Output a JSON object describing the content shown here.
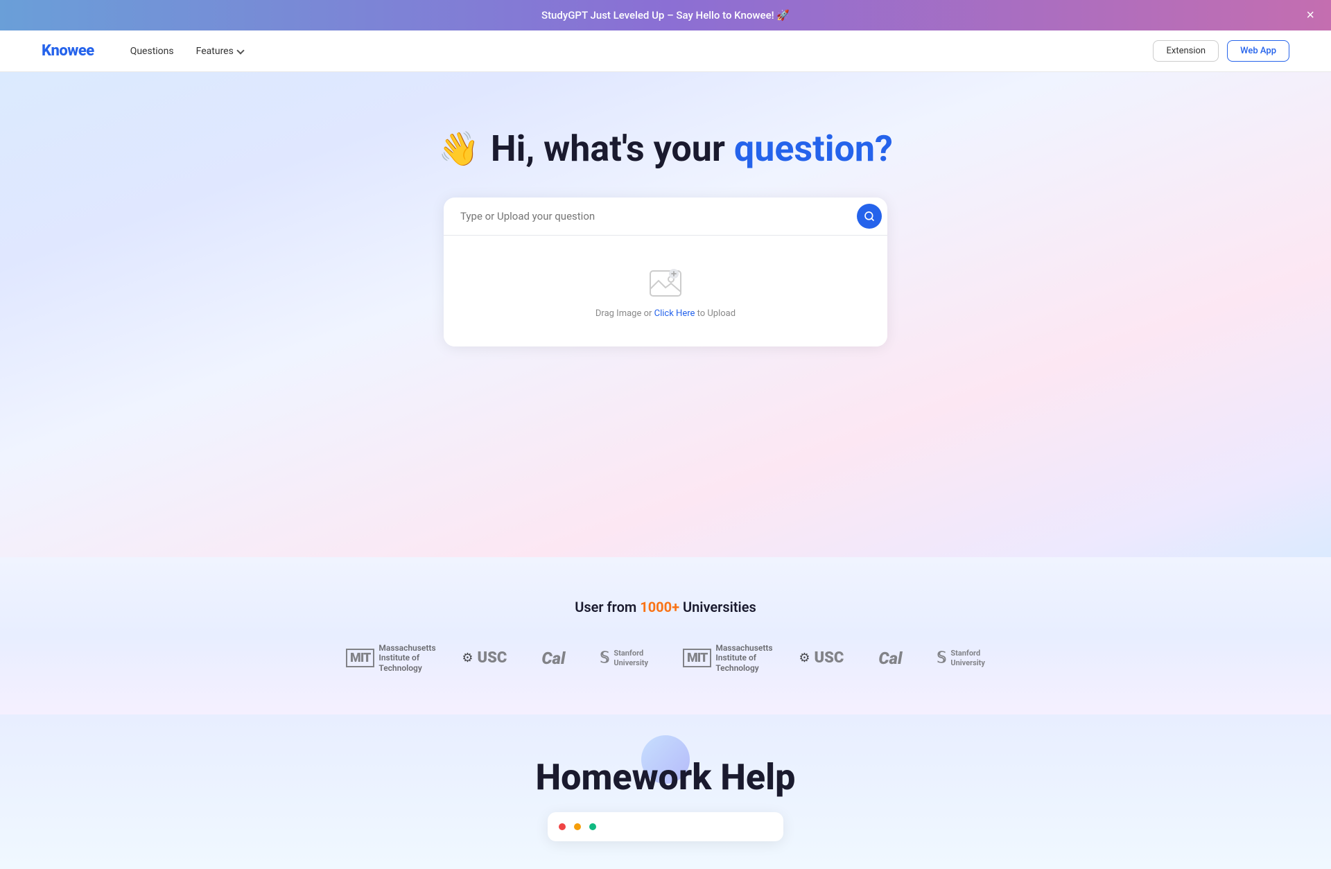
{
  "announcement": {
    "text": "StudyGPT Just Leveled Up – Say Hello to Knowee! 🚀",
    "close_label": "×"
  },
  "navbar": {
    "logo": "Knowee",
    "links": [
      {
        "id": "questions",
        "label": "Questions"
      },
      {
        "id": "features",
        "label": "Features",
        "has_dropdown": true
      }
    ],
    "actions": {
      "extension_label": "Extension",
      "webapp_label": "Web App"
    }
  },
  "hero": {
    "wave_icon": "👋",
    "title_prefix": "Hi, what's your",
    "title_highlight": "question?",
    "search_placeholder": "Type or Upload your question",
    "upload_text_static": "Drag Image or ",
    "upload_click_text": "Click Here",
    "upload_text_suffix": " to Upload"
  },
  "universities": {
    "title_prefix": "User from ",
    "count": "1000+",
    "title_suffix": " Universities",
    "logos": [
      {
        "id": "mit1",
        "type": "mit",
        "name": "Massachusetts Institute of Technology"
      },
      {
        "id": "usc1",
        "type": "usc",
        "name": "USC"
      },
      {
        "id": "cal1",
        "type": "cal",
        "name": "Cal"
      },
      {
        "id": "stanford1",
        "type": "stanford",
        "name": "Stanford University"
      },
      {
        "id": "mit2",
        "type": "mit",
        "name": "Massachusetts Institute of Technology"
      },
      {
        "id": "usc2",
        "type": "usc",
        "name": "USC"
      },
      {
        "id": "cal2",
        "type": "cal",
        "name": "Cal"
      },
      {
        "id": "stanford2",
        "type": "stanford",
        "name": "Stanford University"
      }
    ]
  },
  "homework": {
    "decoration_label": "",
    "title": "Homework Help"
  },
  "colors": {
    "brand_blue": "#2563eb",
    "accent_orange": "#f97316"
  }
}
